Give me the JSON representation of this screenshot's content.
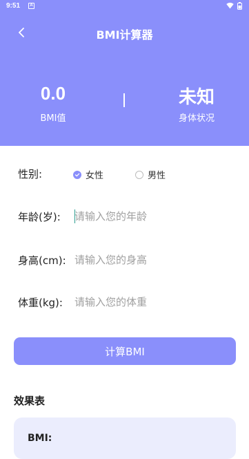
{
  "status_bar": {
    "time": "9:51",
    "notification_icon": "A"
  },
  "header": {
    "title": "BMI计算器",
    "bmi_value": "0.0",
    "bmi_label": "BMI值",
    "body_status_value": "未知",
    "body_status_label": "身体状况"
  },
  "form": {
    "gender_label": "性别:",
    "gender_options": [
      {
        "label": "女性",
        "selected": true
      },
      {
        "label": "男性",
        "selected": false
      }
    ],
    "age_label": "年龄(岁):",
    "age_placeholder": "请输入您的年龄",
    "height_label": "身高(cm):",
    "height_placeholder": "请输入您的身高",
    "weight_label": "体重(kg):",
    "weight_placeholder": "请输入您的体重"
  },
  "calculate_button": "计算BMI",
  "effect_table": {
    "title": "效果表",
    "bmi_label": "BMI:"
  },
  "colors": {
    "accent": "#8a8ffb",
    "card_bg": "#ebedfd"
  }
}
